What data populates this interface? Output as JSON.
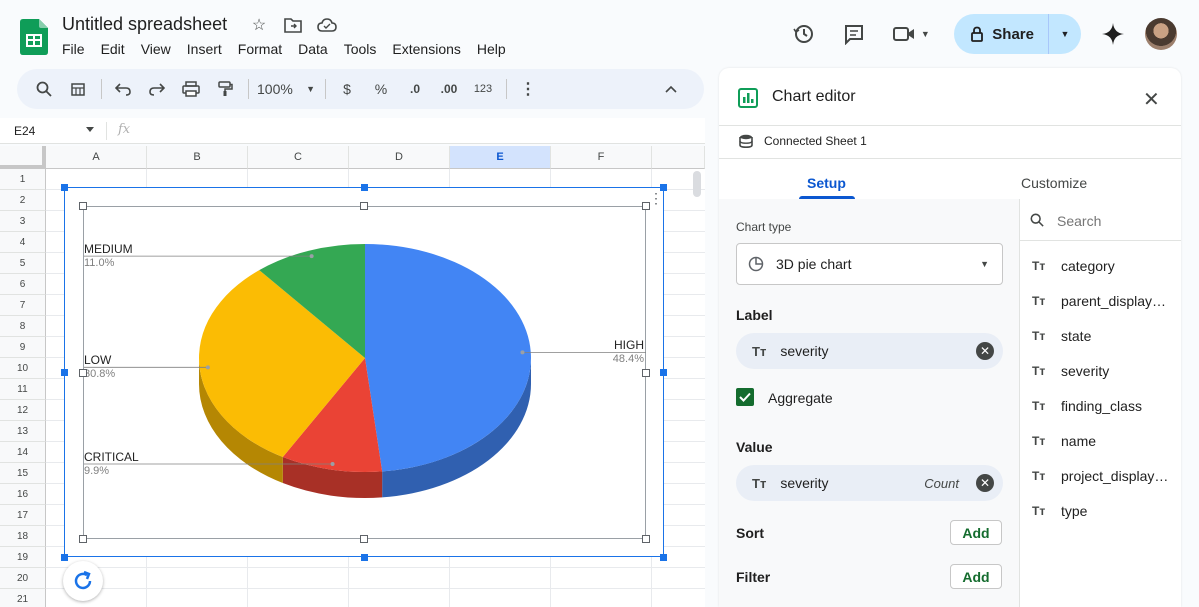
{
  "app": {
    "doc_title": "Untitled spreadsheet",
    "menu": [
      "File",
      "Edit",
      "View",
      "Insert",
      "Format",
      "Data",
      "Tools",
      "Extensions",
      "Help"
    ],
    "share_label": "Share",
    "brand_color": "#0f9d58"
  },
  "toolbar": {
    "zoom": "100%",
    "currency": "$",
    "percent": "%",
    "dec_decrease": ".0",
    "dec_increase": ".00",
    "number_format": "123"
  },
  "formula_bar": {
    "name_box": "E24",
    "fx": "fx"
  },
  "grid": {
    "columns": [
      "A",
      "B",
      "C",
      "D",
      "E",
      "F"
    ],
    "selected_column": "E",
    "rows": [
      "1",
      "2",
      "3",
      "4",
      "5",
      "6",
      "7",
      "8",
      "9",
      "10",
      "11",
      "12",
      "13",
      "14",
      "15",
      "16",
      "17",
      "18",
      "19",
      "20",
      "21"
    ]
  },
  "chart": {
    "type": "3D pie chart",
    "slices": [
      {
        "label": "HIGH",
        "percent": "48.4%",
        "value": 48.4,
        "color": "#4285f4"
      },
      {
        "label": "CRITICAL",
        "percent": "9.9%",
        "value": 9.9,
        "color": "#ea4335"
      },
      {
        "label": "LOW",
        "percent": "30.8%",
        "value": 30.8,
        "color": "#fbbc04"
      },
      {
        "label": "MEDIUM",
        "percent": "11.0%",
        "value": 11.0,
        "color": "#34a853"
      }
    ]
  },
  "chart_data": {
    "type": "pie",
    "categories": [
      "HIGH",
      "CRITICAL",
      "LOW",
      "MEDIUM"
    ],
    "values": [
      48.4,
      9.9,
      30.8,
      11.0
    ],
    "title": "",
    "legend_position": "labeled"
  },
  "editor": {
    "title": "Chart editor",
    "connected": "Connected Sheet 1",
    "tabs": {
      "setup": "Setup",
      "customize": "Customize"
    },
    "chart_type_label": "Chart type",
    "chart_type_value": "3D pie chart",
    "label_section": "Label",
    "label_field": "severity",
    "aggregate_label": "Aggregate",
    "aggregate_checked": true,
    "value_section": "Value",
    "value_field": "severity",
    "value_agg": "Count",
    "sort_section": "Sort",
    "filter_section": "Filter",
    "add_label": "Add",
    "search_placeholder": "Search",
    "fields": [
      "category",
      "parent_display…",
      "state",
      "severity",
      "finding_class",
      "name",
      "project_display…",
      "type"
    ],
    "type_glyph": "Tт"
  }
}
